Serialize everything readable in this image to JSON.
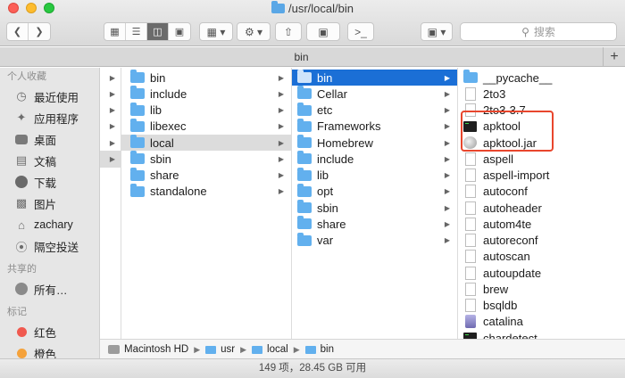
{
  "window": {
    "title": "/usr/local/bin"
  },
  "toolbar": {
    "back_icon": "chevron-left-icon",
    "forward_icon": "chevron-right-icon",
    "search_placeholder": "搜索"
  },
  "tabbar": {
    "tab_label": "bin",
    "add_label": "+"
  },
  "sidebar": {
    "favorites_header": "个人收藏",
    "favorites": [
      {
        "label": "最近使用",
        "icon": "clock-icon"
      },
      {
        "label": "应用程序",
        "icon": "applications-icon"
      },
      {
        "label": "桌面",
        "icon": "desktop-icon"
      },
      {
        "label": "文稿",
        "icon": "document-icon"
      },
      {
        "label": "下载",
        "icon": "download-icon"
      },
      {
        "label": "图片",
        "icon": "pictures-icon"
      },
      {
        "label": "zachary",
        "icon": "home-icon"
      },
      {
        "label": "隔空投送",
        "icon": "airdrop-icon"
      }
    ],
    "shared_header": "共享的",
    "shared": [
      {
        "label": "所有…",
        "icon": "network-icon"
      }
    ],
    "tags_header": "标记",
    "tags": [
      {
        "label": "红色",
        "color": "#f0594f"
      },
      {
        "label": "橙色",
        "color": "#f5a23b"
      }
    ]
  },
  "columns": {
    "col2": [
      "bin",
      "include",
      "lib",
      "libexec",
      "local",
      "sbin",
      "share",
      "standalone"
    ],
    "col3": [
      "bin",
      "Cellar",
      "etc",
      "Frameworks",
      "Homebrew",
      "include",
      "lib",
      "opt",
      "sbin",
      "share",
      "var"
    ],
    "col4": [
      {
        "name": "__pycache__",
        "kind": "folder"
      },
      {
        "name": "2to3",
        "kind": "doc"
      },
      {
        "name": "2to3-3.7",
        "kind": "doc"
      },
      {
        "name": "apktool",
        "kind": "exec"
      },
      {
        "name": "apktool.jar",
        "kind": "jar"
      },
      {
        "name": "aspell",
        "kind": "doc"
      },
      {
        "name": "aspell-import",
        "kind": "doc"
      },
      {
        "name": "autoconf",
        "kind": "doc"
      },
      {
        "name": "autoheader",
        "kind": "doc"
      },
      {
        "name": "autom4te",
        "kind": "doc"
      },
      {
        "name": "autoreconf",
        "kind": "doc"
      },
      {
        "name": "autoscan",
        "kind": "doc"
      },
      {
        "name": "autoupdate",
        "kind": "doc"
      },
      {
        "name": "brew",
        "kind": "doc"
      },
      {
        "name": "bsqldb",
        "kind": "doc"
      },
      {
        "name": "catalina",
        "kind": "catalina"
      },
      {
        "name": "chardetect",
        "kind": "exec"
      }
    ]
  },
  "pathbar": {
    "segments": [
      "Macintosh HD",
      "usr",
      "local",
      "bin"
    ]
  },
  "status": {
    "text": "149 项，28.45 GB 可用"
  },
  "colors": {
    "selection_blue": "#1b6fd6",
    "highlight_red": "#e8462d"
  }
}
